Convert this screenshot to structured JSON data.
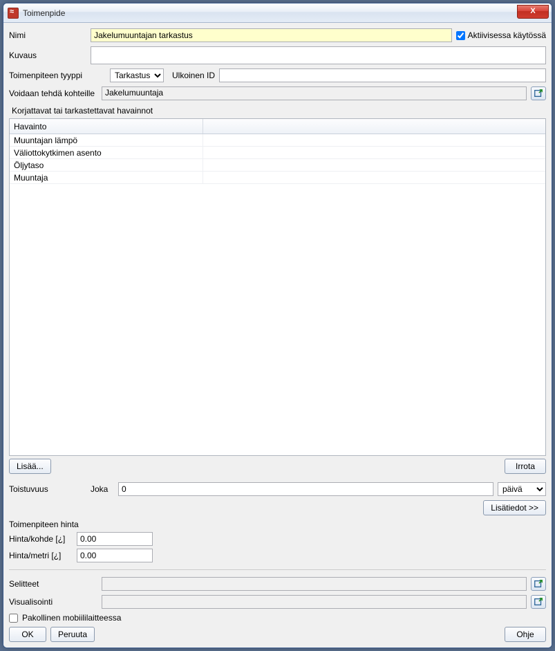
{
  "window": {
    "title": "Toimenpide"
  },
  "labels": {
    "nimi": "Nimi",
    "kuvaus": "Kuvaus",
    "toimenpiteen_tyyppi": "Toimenpiteen tyyppi",
    "ulkoinen_id": "Ulkoinen ID",
    "voidaan_tehda": "Voidaan tehdä kohteille",
    "korjattavat": "Korjattavat tai tarkastettavat havainnot",
    "toistuvuus": "Toistuvuus",
    "joka": "Joka",
    "toimenpiteen_hinta": "Toimenpiteen hinta",
    "hinta_kohde": "Hinta/kohde [¿]",
    "hinta_metri": "Hinta/metri [¿]",
    "selitteet": "Selitteet",
    "visualisointi": "Visualisointi",
    "pakollinen_mobiili": "Pakollinen mobiililaitteessa",
    "aktiivisessa": "Aktiivisessa käytössä"
  },
  "values": {
    "nimi": "Jakelumuuntajan tarkastus",
    "kuvaus": "",
    "tyyppi": "Tarkastus",
    "ulkoinen_id": "",
    "kohteet": "Jakelumuuntaja",
    "joka_count": "0",
    "joka_unit": "päivä",
    "hinta_kohde": "0.00",
    "hinta_metri": "0.00",
    "selitteet": "",
    "visualisointi": "",
    "aktiivisessa_checked": true,
    "pakollinen_checked": false
  },
  "table": {
    "header_col1": "Havainto",
    "header_col2": "",
    "rows": [
      "Muuntajan lämpö",
      "Väliottokytkimen asento",
      "Öljytaso",
      "Muuntaja"
    ]
  },
  "buttons": {
    "lisaa": "Lisää...",
    "irrota": "Irrota",
    "lisatiedot": "Lisätiedot >>",
    "ok": "OK",
    "peruuta": "Peruuta",
    "ohje": "Ohje",
    "close_x": "X"
  }
}
